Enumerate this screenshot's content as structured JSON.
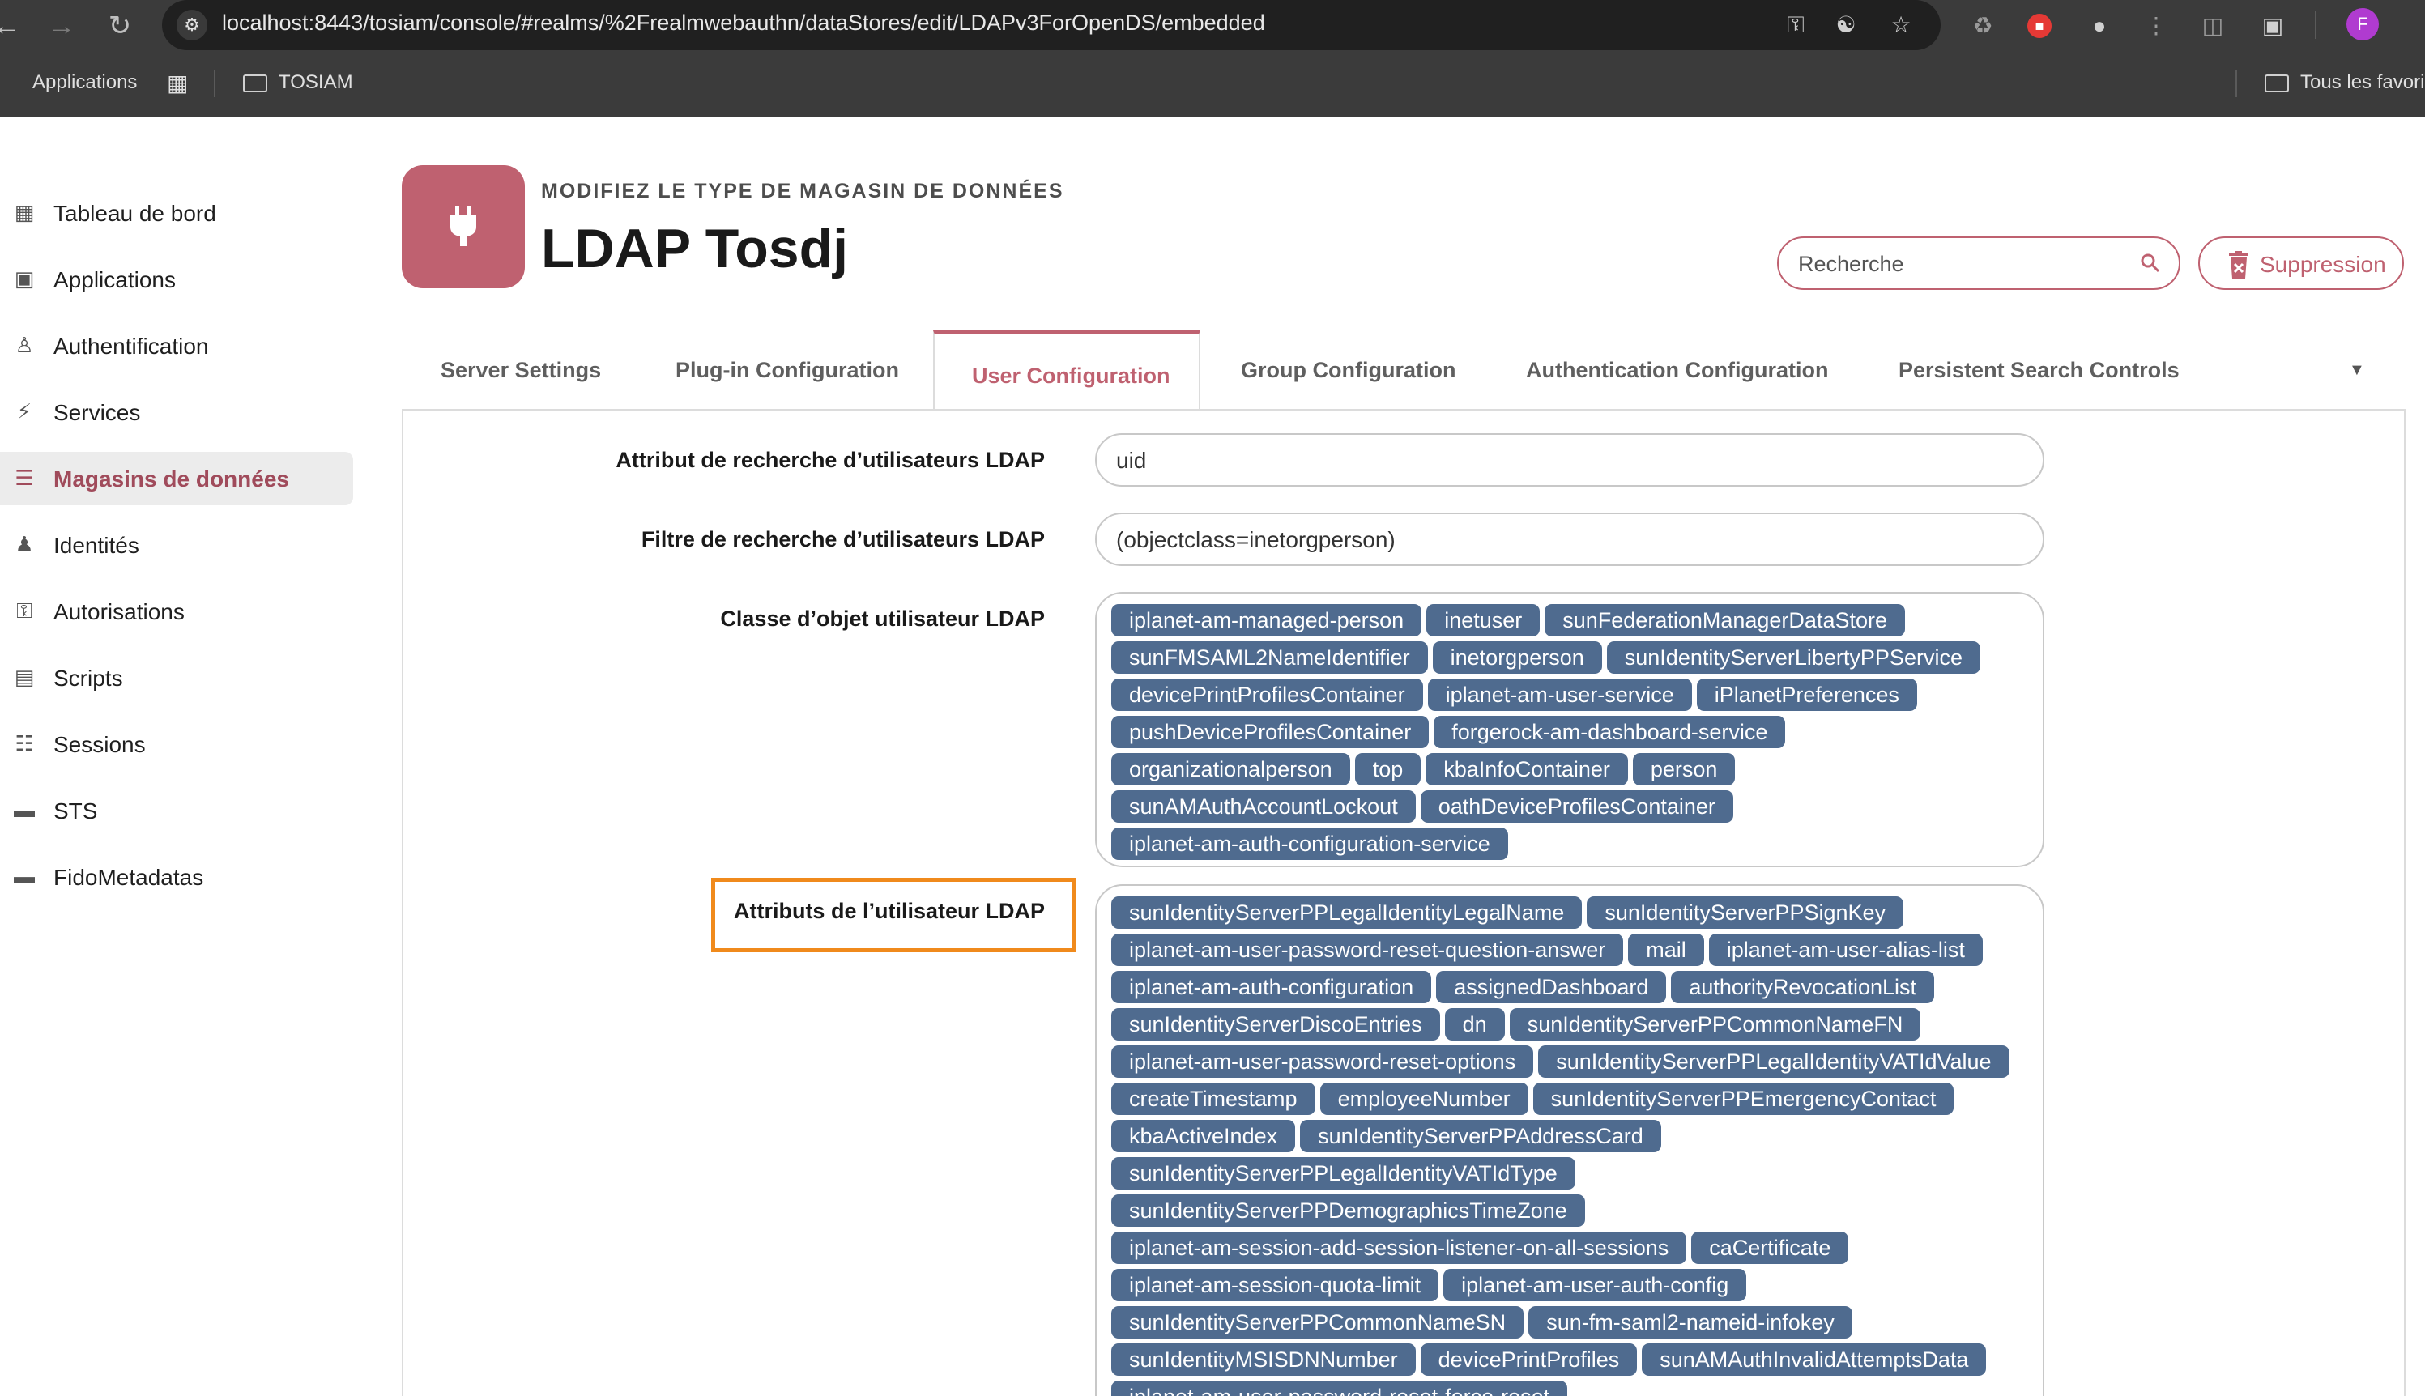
{
  "browser": {
    "url": "localhost:8443/tosiam/console/#realms/%2Frealmwebauthn/dataStores/edit/LDAPv3ForOpenDS/embedded",
    "profile_initial": "F",
    "bookmarks": {
      "apps_label": "Applications",
      "folder_label": "TOSIAM",
      "all_bookmarks_label": "Tous les favori"
    }
  },
  "sidebar": {
    "items": [
      {
        "label": "Tableau de bord",
        "icon": "dashboard-icon"
      },
      {
        "label": "Applications",
        "icon": "applications-icon"
      },
      {
        "label": "Authentification",
        "icon": "user-icon"
      },
      {
        "label": "Services",
        "icon": "plug-icon"
      },
      {
        "label": "Magasins de données",
        "icon": "list-icon"
      },
      {
        "label": "Identités",
        "icon": "identities-icon"
      },
      {
        "label": "Autorisations",
        "icon": "key-icon"
      },
      {
        "label": "Scripts",
        "icon": "script-icon"
      },
      {
        "label": "Sessions",
        "icon": "sessions-icon"
      },
      {
        "label": "STS",
        "icon": "card-icon"
      },
      {
        "label": "FidoMetadatas",
        "icon": "card-icon"
      }
    ],
    "active_label": "Magasins de données"
  },
  "header": {
    "subtitle": "MODIFIEZ LE TYPE DE MAGASIN DE DONNÉES",
    "title": "LDAP Tosdj",
    "search_placeholder": "Recherche",
    "delete_label": "Suppression",
    "accent": "#bf6170"
  },
  "tabs": [
    {
      "label": "Server Settings"
    },
    {
      "label": "Plug-in Configuration"
    },
    {
      "label": "User Configuration"
    },
    {
      "label": "Group Configuration"
    },
    {
      "label": "Authentication Configuration"
    },
    {
      "label": "Persistent Search Controls"
    }
  ],
  "active_tab": "User Configuration",
  "form": {
    "search_attribute": {
      "label": "Attribut de recherche d’utilisateurs LDAP",
      "value": "uid"
    },
    "search_filter": {
      "label": "Filtre de recherche d’utilisateurs LDAP",
      "value": "(objectclass=inetorgperson)"
    },
    "object_class": {
      "label": "Classe d’objet utilisateur LDAP",
      "tags": [
        "iplanet-am-managed-person",
        "inetuser",
        "sunFederationManagerDataStore",
        "sunFMSAML2NameIdentifier",
        "inetorgperson",
        "sunIdentityServerLibertyPPService",
        "devicePrintProfilesContainer",
        "iplanet-am-user-service",
        "iPlanetPreferences",
        "pushDeviceProfilesContainer",
        "forgerock-am-dashboard-service",
        "organizationalperson",
        "top",
        "kbaInfoContainer",
        "person",
        "sunAMAuthAccountLockout",
        "oathDeviceProfilesContainer",
        "iplanet-am-auth-configuration-service"
      ]
    },
    "user_attributes": {
      "label": "Attributs de l’utilisateur LDAP",
      "tags": [
        "sunIdentityServerPPLegalIdentityLegalName",
        "sunIdentityServerPPSignKey",
        "iplanet-am-user-password-reset-question-answer",
        "mail",
        "iplanet-am-user-alias-list",
        "iplanet-am-auth-configuration",
        "assignedDashboard",
        "authorityRevocationList",
        "sunIdentityServerDiscoEntries",
        "dn",
        "sunIdentityServerPPCommonNameFN",
        "iplanet-am-user-password-reset-options",
        "sunIdentityServerPPLegalIdentityVATIdValue",
        "createTimestamp",
        "employeeNumber",
        "sunIdentityServerPPEmergencyContact",
        "kbaActiveIndex",
        "sunIdentityServerPPAddressCard",
        "sunIdentityServerPPLegalIdentityVATIdType",
        "sunIdentityServerPPDemographicsTimeZone",
        "iplanet-am-session-add-session-listener-on-all-sessions",
        "caCertificate",
        "iplanet-am-session-quota-limit",
        "iplanet-am-user-auth-config",
        "sunIdentityServerPPCommonNameSN",
        "sun-fm-saml2-nameid-infokey",
        "sunIdentityMSISDNNumber",
        "devicePrintProfiles",
        "sunAMAuthInvalidAttemptsData",
        "iplanet-am-user-password-reset-force-reset"
      ]
    },
    "tag_color": "#4f6b8f",
    "highlight_color": "#f08a1c"
  }
}
